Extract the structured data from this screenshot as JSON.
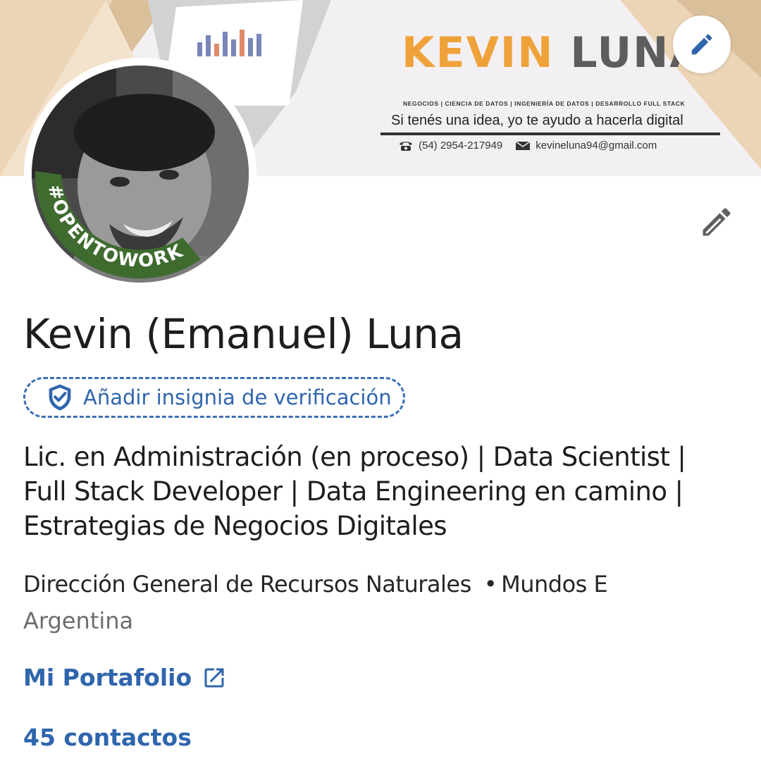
{
  "banner": {
    "brand_first": "KEVIN",
    "brand_last": "LUNA",
    "tagline_small": "NEGOCIOS | CIENCIA DE DATOS | INGENIERÍA DE DATOS | DESARROLLO FULL STACK",
    "slogan": "Si tenés una idea, yo te ayudo a hacerla digital",
    "phone": "(54) 2954-217949",
    "email": "kevineluna94@gmail.com",
    "colors": {
      "brand_first": "#efa23a",
      "brand_last": "#5d5d5d"
    },
    "edit_icon": "pencil-icon"
  },
  "avatar": {
    "badge_text": "#OPENTOWORK",
    "badge_color": "#3f6b2f"
  },
  "profile": {
    "name": "Kevin (Emanuel) Luna",
    "verify_label": "Añadir insignia de verificación",
    "headline": "Lic. en Administración (en proceso) | Data Scientist | Full Stack Developer | Data Engineering en camino | Estrategias de Negocios Digitales",
    "company": "Dirección General de Recursos Naturales",
    "company_separator": "•",
    "company_second": "Mundos E",
    "location": "Argentina",
    "portfolio_label": "Mi Portafolio",
    "contacts": "45 contactos",
    "accent_color": "#2f65ad"
  }
}
